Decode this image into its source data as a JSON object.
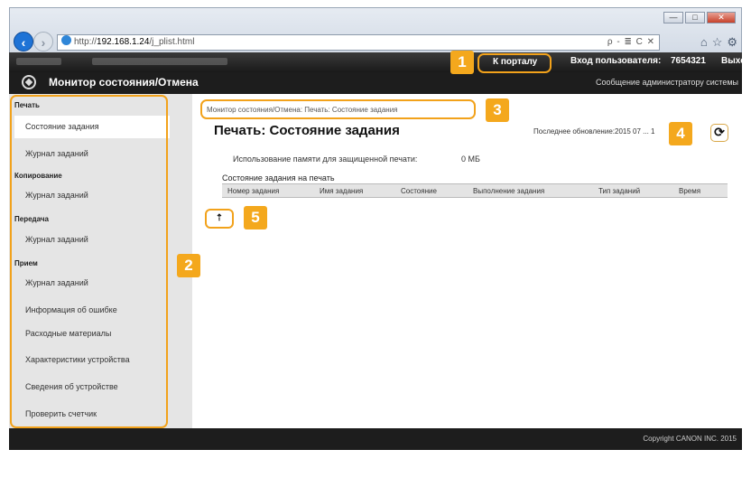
{
  "browser": {
    "url_prefix": "http://",
    "url_host": "192.168.1.24",
    "url_path": "/j_plist.html",
    "address_controls": "ρ - ≣ C ✕",
    "window_buttons": [
      "—",
      "□",
      "✕"
    ],
    "toolbar_icons": [
      "⌂",
      "☆",
      "⚙"
    ]
  },
  "header": {
    "portal_link": "К порталу",
    "login_label": "Вход пользователя:",
    "login_name": "7654321",
    "logout_link": "Выход",
    "app_title": "Монитор состояния/Отмена",
    "admin_message": "Сообщение администратору системы"
  },
  "sidebar": {
    "groups": {
      "print": "Печать",
      "copy": "Копирование",
      "send": "Передача",
      "receive": "Прием"
    },
    "items": {
      "print_job_status": "Состояние задания",
      "print_job_log": "Журнал заданий",
      "copy_job_log": "Журнал заданий",
      "send_job_log": "Журнал заданий",
      "receive_job_log": "Журнал заданий",
      "error_info": "Информация об ошибке",
      "consumables": "Расходные материалы",
      "device_features": "Характеристики устройства",
      "device_info": "Сведения об устройстве",
      "check_counter": "Проверить счетчик"
    }
  },
  "main": {
    "breadcrumb": "Монитор состояния/Отмена: Печать: Состояние задания",
    "page_title": "Печать: Состояние задания",
    "last_updated": "Последнее обновление:2015 07 ... 1",
    "secure_memory_label": "Использование памяти для защищенной печати:",
    "secure_memory_value": "0 МБ",
    "jobs_caption": "Состояние задания на печать",
    "table_headers": [
      "Номер задания",
      "Имя задания",
      "Состояние",
      "Выполнение задания",
      "Тип заданий",
      "Время"
    ],
    "refresh_symbol": "⟳",
    "top_symbol": "⇡"
  },
  "footer": {
    "copyright": "Copyright CANON INC. 2015"
  },
  "callouts": [
    "1",
    "2",
    "3",
    "4",
    "5"
  ],
  "colors": {
    "accent": "#f4a81d",
    "header_bg": "#1d1d1d",
    "sidebar_bg": "#e5e5e5"
  }
}
